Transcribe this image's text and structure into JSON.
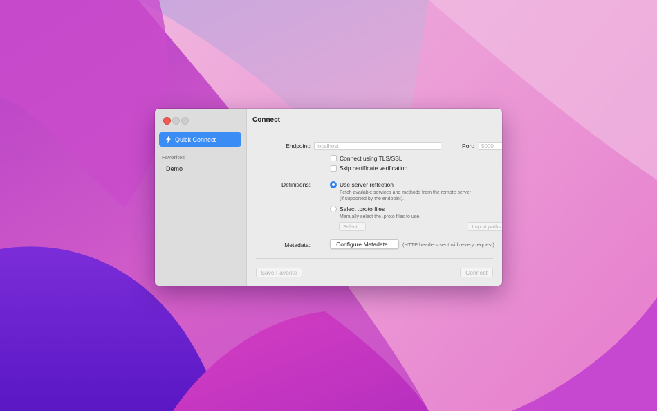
{
  "sidebar": {
    "quick_connect": "Quick Connect",
    "favorites_header": "Favorites",
    "favorites": [
      "Demo"
    ]
  },
  "main": {
    "title": "Connect",
    "endpoint_label": "Endpoint:",
    "endpoint_placeholder": "localhost",
    "port_label": "Port:",
    "port_placeholder": "5000",
    "tls_option": "Connect using TLS/SSL",
    "skip_cert_option": "Skip certificate verification",
    "definitions_label": "Definitions:",
    "reflection_option": "Use server reflection",
    "reflection_desc_1": "Fetch available services and methods from the remote server",
    "reflection_desc_2": "(if supported by the endpoint).",
    "proto_option": "Select .proto files",
    "proto_desc": "Manually select the .proto files to use.",
    "select_button": "Select...",
    "import_paths_button": "Import paths...",
    "metadata_label": "Metadata:",
    "configure_metadata_button": "Configure Metadata...",
    "metadata_hint": "(HTTP headers sent with every request)",
    "save_favorite_button": "Save Favorite",
    "connect_button": "Connect"
  },
  "colors": {
    "accent": "#3b8cf5",
    "radio_selected": "#2f7ff3",
    "close_button": "#ee5c55"
  }
}
